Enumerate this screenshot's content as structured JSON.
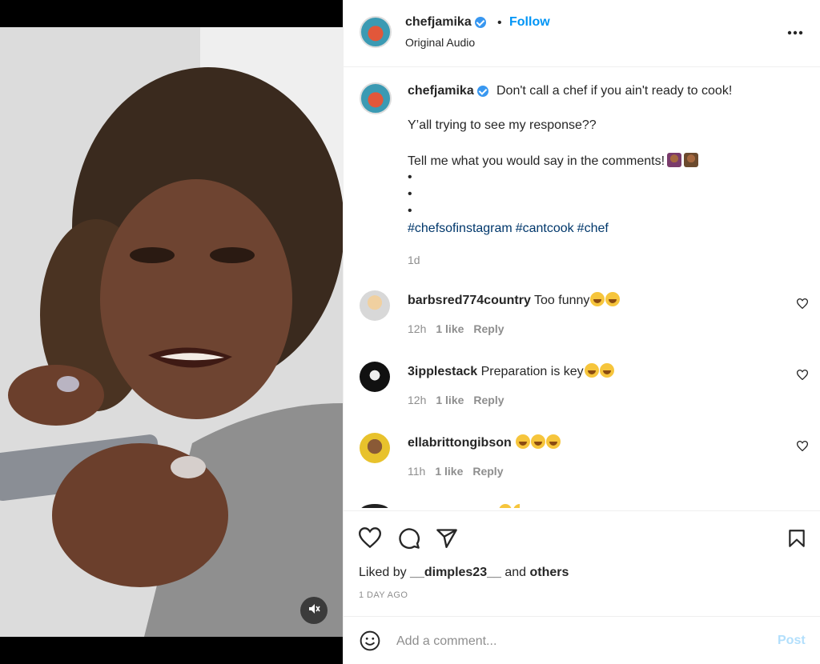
{
  "post": {
    "username": "chefjamika",
    "follow_label": "Follow",
    "audio_label": "Original Audio",
    "separator": "•"
  },
  "caption": {
    "username": "chefjamika",
    "headline": "Don't call a chef if you ain't ready to cook!",
    "line2": "Y’all trying to see my response??",
    "line3": "Tell me what you would say in the comments!",
    "bullets": [
      "•",
      "•",
      "•"
    ],
    "hashtags": [
      "#chefsofinstagram",
      "#cantcook",
      "#chef"
    ],
    "time": "1d"
  },
  "comments": [
    {
      "username": "barbsred774country",
      "text": "Too funny",
      "emoji_count": 2,
      "time": "12h",
      "likes": "1 like",
      "reply": "Reply"
    },
    {
      "username": "3ipplestack",
      "text": "Preparation is key",
      "emoji_count": 2,
      "time": "12h",
      "likes": "1 like",
      "reply": "Reply"
    },
    {
      "username": "ellabrittongibson",
      "text": "",
      "emoji_count": 3,
      "time": "11h",
      "likes": "1 like",
      "reply": "Reply"
    }
  ],
  "actions": {
    "liked_prefix": "Liked by",
    "liked_user": "__dimples23__",
    "liked_and": "and",
    "liked_others": "others",
    "date": "1 DAY AGO"
  },
  "comment_bar": {
    "placeholder": "Add a comment...",
    "post_label": "Post"
  },
  "icons": {
    "header_more": "more-horizontal-icon",
    "mute": "speaker-muted-icon",
    "like": "heart-icon",
    "comment": "comment-bubble-icon",
    "share": "paper-plane-icon",
    "save": "bookmark-icon",
    "emoji": "smiley-icon"
  },
  "colors": {
    "accent": "#0095f6",
    "hashtag": "#00376b",
    "muted": "#8e8e8e",
    "post_disabled": "#b2dffc"
  }
}
